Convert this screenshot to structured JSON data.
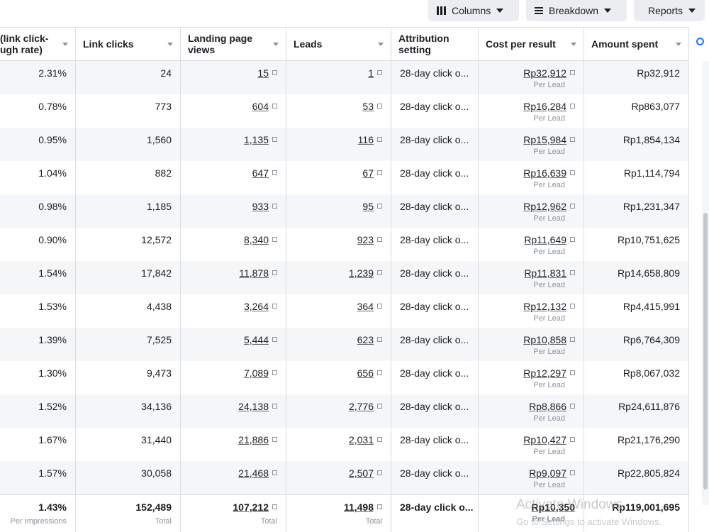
{
  "toolbar": {
    "columns_label": "Columns",
    "breakdown_label": "Breakdown",
    "reports_label": "Reports"
  },
  "table": {
    "headers": {
      "ctr": "(link click-\nugh rate)",
      "link_clicks": "Link clicks",
      "lpv": "Landing page views",
      "leads": "Leads",
      "attribution": "Attribution setting",
      "cost_per_result": "Cost per result",
      "amount_spent": "Amount spent"
    },
    "rows": [
      {
        "ctr": "2.31%",
        "link_clicks": "24",
        "lpv": "15",
        "leads": "1",
        "attribution": "28-day click o...",
        "cost": "Rp32,912",
        "cost_sub": "Per Lead",
        "spent": "Rp32,912"
      },
      {
        "ctr": "0.78%",
        "link_clicks": "773",
        "lpv": "604",
        "leads": "53",
        "attribution": "28-day click o...",
        "cost": "Rp16,284",
        "cost_sub": "Per Lead",
        "spent": "Rp863,077"
      },
      {
        "ctr": "0.95%",
        "link_clicks": "1,560",
        "lpv": "1,135",
        "leads": "116",
        "attribution": "28-day click o...",
        "cost": "Rp15,984",
        "cost_sub": "Per Lead",
        "spent": "Rp1,854,134"
      },
      {
        "ctr": "1.04%",
        "link_clicks": "882",
        "lpv": "647",
        "leads": "67",
        "attribution": "28-day click o...",
        "cost": "Rp16,639",
        "cost_sub": "Per Lead",
        "spent": "Rp1,114,794"
      },
      {
        "ctr": "0.98%",
        "link_clicks": "1,185",
        "lpv": "933",
        "leads": "95",
        "attribution": "28-day click o...",
        "cost": "Rp12,962",
        "cost_sub": "Per Lead",
        "spent": "Rp1,231,347"
      },
      {
        "ctr": "0.90%",
        "link_clicks": "12,572",
        "lpv": "8,340",
        "leads": "923",
        "attribution": "28-day click o...",
        "cost": "Rp11,649",
        "cost_sub": "Per Lead",
        "spent": "Rp10,751,625"
      },
      {
        "ctr": "1.54%",
        "link_clicks": "17,842",
        "lpv": "11,878",
        "leads": "1,239",
        "attribution": "28-day click o...",
        "cost": "Rp11,831",
        "cost_sub": "Per Lead",
        "spent": "Rp14,658,809"
      },
      {
        "ctr": "1.53%",
        "link_clicks": "4,438",
        "lpv": "3,264",
        "leads": "364",
        "attribution": "28-day click o...",
        "cost": "Rp12,132",
        "cost_sub": "Per Lead",
        "spent": "Rp4,415,991"
      },
      {
        "ctr": "1.39%",
        "link_clicks": "7,525",
        "lpv": "5,444",
        "leads": "623",
        "attribution": "28-day click o...",
        "cost": "Rp10,858",
        "cost_sub": "Per Lead",
        "spent": "Rp6,764,309"
      },
      {
        "ctr": "1.30%",
        "link_clicks": "9,473",
        "lpv": "7,089",
        "leads": "656",
        "attribution": "28-day click o...",
        "cost": "Rp12,297",
        "cost_sub": "Per Lead",
        "spent": "Rp8,067,032"
      },
      {
        "ctr": "1.52%",
        "link_clicks": "34,136",
        "lpv": "24,138",
        "leads": "2,776",
        "attribution": "28-day click o...",
        "cost": "Rp8,866",
        "cost_sub": "Per Lead",
        "spent": "Rp24,611,876"
      },
      {
        "ctr": "1.67%",
        "link_clicks": "31,440",
        "lpv": "21,886",
        "leads": "2,031",
        "attribution": "28-day click o...",
        "cost": "Rp10,427",
        "cost_sub": "Per Lead",
        "spent": "Rp21,176,290"
      },
      {
        "ctr": "1.57%",
        "link_clicks": "30,058",
        "lpv": "21,468",
        "leads": "2,507",
        "attribution": "28-day click o...",
        "cost": "Rp9,097",
        "cost_sub": "Per Lead",
        "spent": "Rp22,805,824"
      }
    ],
    "totals": {
      "ctr": "1.43%",
      "ctr_sub": "Per Impressions",
      "link_clicks": "152,489",
      "link_clicks_sub": "Total",
      "lpv": "107,212",
      "lpv_sub": "Total",
      "leads": "11,498",
      "leads_sub": "Total",
      "attribution": "28-day click o...",
      "cost": "Rp10,350",
      "cost_sub": "Per Lead",
      "spent": "Rp119,001,695"
    }
  },
  "watermark": {
    "line1": "Activate Windows",
    "line2": "Go to Settings to activate Windows."
  }
}
